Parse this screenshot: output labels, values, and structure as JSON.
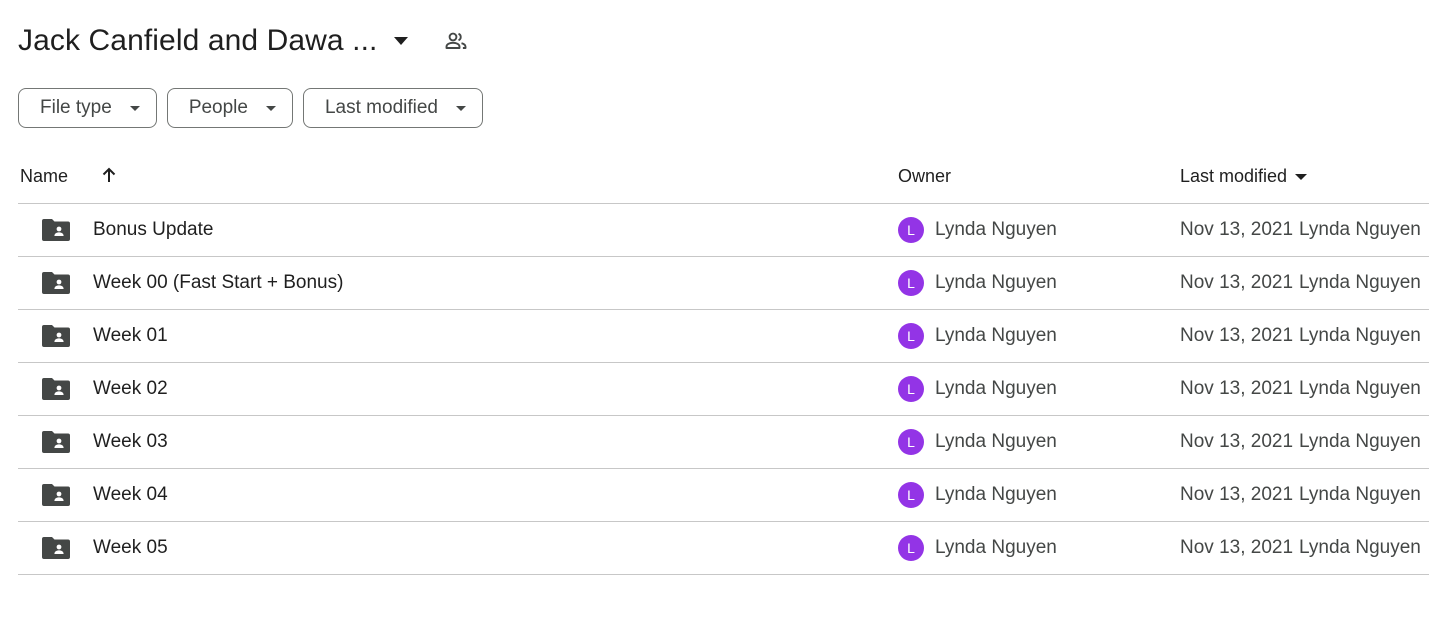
{
  "header": {
    "title": "Jack Canfield and Dawa ...",
    "title_caret_icon": "arrow-drop-down-icon",
    "share_icon": "people-icon"
  },
  "filters": [
    {
      "label": "File type"
    },
    {
      "label": "People"
    },
    {
      "label": "Last modified"
    }
  ],
  "table": {
    "columns": {
      "name": "Name",
      "owner": "Owner",
      "last_modified": "Last modified"
    },
    "sort": {
      "column": "name",
      "direction": "ascending",
      "icon": "arrow-up-icon"
    },
    "rows": [
      {
        "name": "Bonus Update",
        "owner_initial": "L",
        "owner": "Lynda Nguyen",
        "modified_date": "Nov 13, 2021",
        "modified_by": "Lynda Nguyen"
      },
      {
        "name": "Week 00 (Fast Start + Bonus)",
        "owner_initial": "L",
        "owner": "Lynda Nguyen",
        "modified_date": "Nov 13, 2021",
        "modified_by": "Lynda Nguyen"
      },
      {
        "name": "Week 01",
        "owner_initial": "L",
        "owner": "Lynda Nguyen",
        "modified_date": "Nov 13, 2021",
        "modified_by": "Lynda Nguyen"
      },
      {
        "name": "Week 02",
        "owner_initial": "L",
        "owner": "Lynda Nguyen",
        "modified_date": "Nov 13, 2021",
        "modified_by": "Lynda Nguyen"
      },
      {
        "name": "Week 03",
        "owner_initial": "L",
        "owner": "Lynda Nguyen",
        "modified_date": "Nov 13, 2021",
        "modified_by": "Lynda Nguyen"
      },
      {
        "name": "Week 04",
        "owner_initial": "L",
        "owner": "Lynda Nguyen",
        "modified_date": "Nov 13, 2021",
        "modified_by": "Lynda Nguyen"
      },
      {
        "name": "Week 05",
        "owner_initial": "L",
        "owner": "Lynda Nguyen",
        "modified_date": "Nov 13, 2021",
        "modified_by": "Lynda Nguyen"
      }
    ]
  },
  "colors": {
    "avatar": "#9334e6",
    "text": "#1f1f1f",
    "secondary_text": "#444746",
    "divider": "#c7c7c7",
    "icon": "#444746"
  }
}
